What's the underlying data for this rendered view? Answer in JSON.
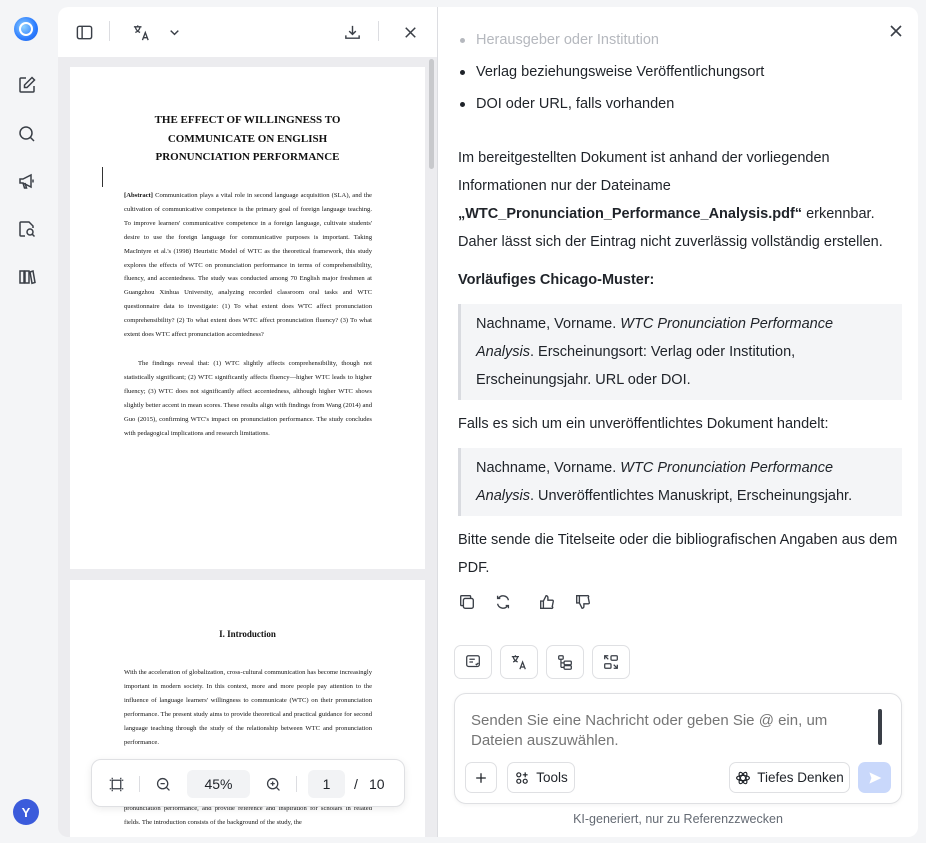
{
  "rail": {
    "avatar_initial": "Y"
  },
  "pdf": {
    "page1": {
      "title": "THE EFFECT OF WILLINGNESS TO COMMUNICATE ON ENGLISH PRONUNCIATION PERFORMANCE",
      "abstract_label": "[Abstract]",
      "abstract_text": " Communication plays a vital role in second language acquisition (SLA), and the cultivation of communicative competence is the primary goal of foreign language teaching. To improve learners' communicative competence in a foreign language, cultivate students' desire to use the foreign language for communicative purposes is important. Taking MacIntyre et al.'s (1998) Heuristic Model of WTC as the theoretical framework, this study explores the effects of WTC on pronunciation performance in terms of comprehensibility, fluency, and accentedness. The study was conducted among 70 English major freshmen at Guangzhou Xinhua University, analyzing recorded classroom oral tasks and WTC questionnaire data to investigate: (1) To what extent does WTC affect pronunciation comprehensibility? (2) To what extent does WTC affect pronunciation fluency? (3) To what extent does WTC affect pronunciation accentedness?",
      "findings_text": "The findings reveal that: (1) WTC slightly affects comprehensibility, though not statistically significant; (2) WTC significantly affects fluency—higher WTC leads to higher fluency; (3) WTC does not significantly affect accentedness, although higher WTC shows slightly better accent in mean scores. These results align with findings from Wang (2014) and Guo (2015), confirming WTC's impact on pronunciation performance. The study concludes with pedagogical implications and research limitations."
    },
    "page2": {
      "heading": "I. Introduction",
      "para1": "With the acceleration of globalization, cross-cultural communication has become increasingly important in modern society. In this context, more and more people pay attention to the influence of language learners' willingness to communicate (WTC) on their pronunciation performance. The present study aims to provide theoretical and practical guidance for second language teaching through the study of the relationship between WTC and pronunciation performance.",
      "para2": "pronunciation performance, and provide reference and inspiration for scholars in related fields. The introduction consists of the background of the study, the"
    },
    "zoom": {
      "level": "45%",
      "current_page": "1",
      "separator": "/",
      "total_pages": "10"
    }
  },
  "chat": {
    "bullets": [
      "Herausgeber oder Institution",
      "Verlag beziehungsweise Veröffentlichungsort",
      "DOI oder URL, falls vorhanden"
    ],
    "para_intro_a": "Im bereitgestellten Dokument ist anhand der vorliegenden Informationen nur der Dateiname ",
    "para_intro_filename": "„WTC_Pronunciation_Performance_Analysis.pdf“",
    "para_intro_b": " erkennbar. Daher lässt sich der Eintrag nicht zuverlässig vollständig erstellen.",
    "heading_chicago": "Vorläufiges Chicago-Muster:",
    "quote1_a": "Nachname, Vorname. ",
    "quote1_italic": "WTC Pronunciation Performance Analysis",
    "quote1_b": ". Erscheinungsort: Verlag oder Institution, Erscheinungsjahr. URL oder DOI.",
    "para_unpublished": "Falls es sich um ein unveröffentlichtes Dokument handelt:",
    "quote2_a": "Nachname, Vorname. ",
    "quote2_italic": "WTC Pronunciation Performance Analysis",
    "quote2_b": ". Unveröffentlichtes Manuskript, Erscheinungsjahr.",
    "para_request": "Bitte sende die Titelseite oder die bibliografischen Angaben aus dem PDF.",
    "composer": {
      "placeholder": "Senden Sie eine Nachricht oder geben Sie @ ein, um Dateien auszuwählen.",
      "tools_label": "Tools",
      "deep_think_label": "Tiefes Denken"
    },
    "footer_note": "KI-generiert, nur zu Referenzzwecken"
  }
}
